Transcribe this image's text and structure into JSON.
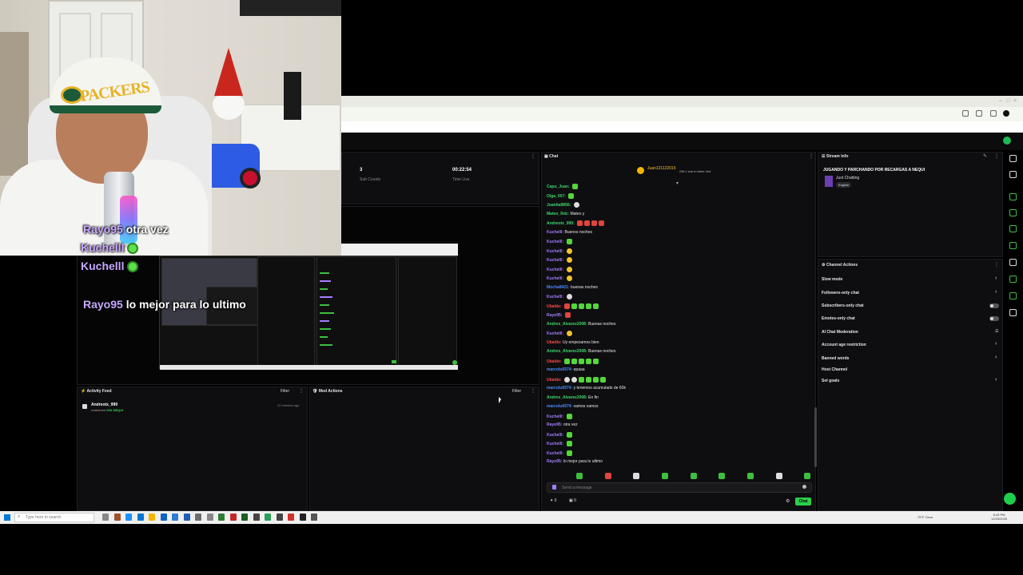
{
  "browser": {
    "window_controls": [
      "–",
      "□",
      "×"
    ]
  },
  "overlay_chat": [
    {
      "name": "Rayo95",
      "msg": "otra vez",
      "emote": false
    },
    {
      "name": "Kuchelll",
      "msg": "",
      "emote": true
    },
    {
      "name": "Kuchelll",
      "msg": "",
      "emote": true
    },
    {
      "name": "Rayo95",
      "msg": "lo mejor para lo ultimo",
      "emote": false
    }
  ],
  "webcam": {
    "cap_text": "PACKERS"
  },
  "stats": {
    "sub_count_value": "3",
    "sub_count_label": "Sub Counts",
    "time_live_value": "00:22:54",
    "time_live_label": "Time Live"
  },
  "chat": {
    "title": "Chat",
    "pinned_user": "Juan121122015",
    "pinned_text": "Gift 1 sub to bebe 2nd",
    "messages": [
      {
        "user": "Capu_Juan",
        "color": "u-green",
        "text": "",
        "emotes": "g"
      },
      {
        "user": "Olga_007",
        "color": "u-green",
        "text": "",
        "emotes": "g"
      },
      {
        "user": "Juanita9856",
        "color": "u-green",
        "text": "",
        "emotes": "w"
      },
      {
        "user": "Mateo_Rdz",
        "color": "u-green",
        "text": "Mateo y",
        "emotes": ""
      },
      {
        "user": "Andreotx_999",
        "color": "u-green",
        "text": "",
        "emotes": "rrrr"
      },
      {
        "user": "Kuchelll",
        "color": "u-purple",
        "text": "Buenos noches",
        "emotes": ""
      },
      {
        "user": "Kuchelll",
        "color": "u-purple",
        "text": "",
        "emotes": "g"
      },
      {
        "user": "Kuchelll",
        "color": "u-purple",
        "text": "",
        "emotes": "y"
      },
      {
        "user": "Kuchelll",
        "color": "u-purple",
        "text": "",
        "emotes": "y"
      },
      {
        "user": "Kuchelll",
        "color": "u-purple",
        "text": "",
        "emotes": "y"
      },
      {
        "user": "Kuchelll",
        "color": "u-purple",
        "text": "",
        "emotes": "y"
      },
      {
        "user": "Mocha8421",
        "color": "u-blue",
        "text": "buenas noches",
        "emotes": ""
      },
      {
        "user": "Kuchelll",
        "color": "u-purple",
        "text": "",
        "emotes": "w"
      },
      {
        "user": "Ubaldo",
        "color": "u-red",
        "text": "",
        "emotes": "rgggg"
      },
      {
        "user": "Rayo95",
        "color": "u-purple",
        "text": "",
        "emotes": "r"
      },
      {
        "user": "Andres_Alvarez2008",
        "color": "u-green",
        "text": "Buenas noches",
        "emotes": ""
      },
      {
        "user": "Kuchelll",
        "color": "u-purple",
        "text": "",
        "emotes": "y"
      },
      {
        "user": "Ubaldo",
        "color": "u-red",
        "text": "Uy empezamos bien",
        "emotes": ""
      },
      {
        "user": "Andres_Alvarez2008",
        "color": "u-green",
        "text": "Buenas noches",
        "emotes": ""
      },
      {
        "user": "Ubaldo",
        "color": "u-red",
        "text": "",
        "emotes": "ggggg"
      },
      {
        "user": "marcolu6574",
        "color": "u-blue",
        "text": "epaaa",
        "emotes": ""
      },
      {
        "user": "Ubaldo",
        "color": "u-red",
        "text": "",
        "emotes": "wwgggg"
      },
      {
        "user": "marcolu6574",
        "color": "u-blue",
        "text": "y tenemos acumulado de 60k",
        "emotes": ""
      },
      {
        "user": "Andres_Alvarez2008",
        "color": "u-green",
        "text": "En fin",
        "emotes": ""
      },
      {
        "user": "marcolu6574",
        "color": "u-blue",
        "text": "vamos vamos",
        "emotes": ""
      },
      {
        "user": "Kuchelll",
        "color": "u-purple",
        "text": "",
        "emotes": "g"
      },
      {
        "user": "Rayo95",
        "color": "u-purple",
        "text": "otra vez",
        "emotes": ""
      },
      {
        "user": "Kuchelll",
        "color": "u-purple",
        "text": "",
        "emotes": "g"
      },
      {
        "user": "Kuchelll",
        "color": "u-purple",
        "text": "",
        "emotes": "g"
      },
      {
        "user": "Kuchelll",
        "color": "u-purple",
        "text": "",
        "emotes": "g"
      },
      {
        "user": "Rayo95",
        "color": "u-purple",
        "text": "lo mejor para lo ultimo",
        "emotes": ""
      }
    ],
    "input_placeholder": "Send a message",
    "send_label": "Chat",
    "points": "0",
    "bits": "0"
  },
  "stream_info": {
    "title_label": "Stream Info",
    "stream_title": "JUGANDO Y PARCHANDO POR RECARGAS A NEQUI",
    "category": "Just Chatting",
    "tag": "English"
  },
  "channel_actions": {
    "title": "Channel Actions",
    "items": [
      {
        "label": "Slow mode",
        "kind": "chevron"
      },
      {
        "label": "Followers-only chat",
        "kind": "chevron"
      },
      {
        "label": "Subscribers-only chat",
        "kind": "toggle"
      },
      {
        "label": "Emotes-only chat",
        "kind": "toggle"
      },
      {
        "label": "AI Chat Moderation",
        "kind": "icon"
      },
      {
        "label": "Account age restriction",
        "kind": "chevron"
      },
      {
        "label": "Banned words",
        "kind": "chevron"
      },
      {
        "label": "Host Channel",
        "kind": "none"
      },
      {
        "label": "Set goals",
        "kind": "chevron"
      }
    ]
  },
  "activity_feed": {
    "title": "Activity Feed",
    "filter_label": "Filter",
    "item_name": "Andreotx_999",
    "item_action": "redeemed",
    "item_amount": "20K NEQUI",
    "item_time": "12 minutes ago"
  },
  "mod_actions": {
    "title": "Mod Actions",
    "filter_label": "Filter"
  },
  "taskbar": {
    "search_placeholder": "Type here to search",
    "weather": "75°F Clear",
    "time": "8:43 PM",
    "date": "12/25/2025"
  },
  "colors": {
    "accent": "#2ccf4a",
    "panel_bg": "#0e0e10"
  }
}
